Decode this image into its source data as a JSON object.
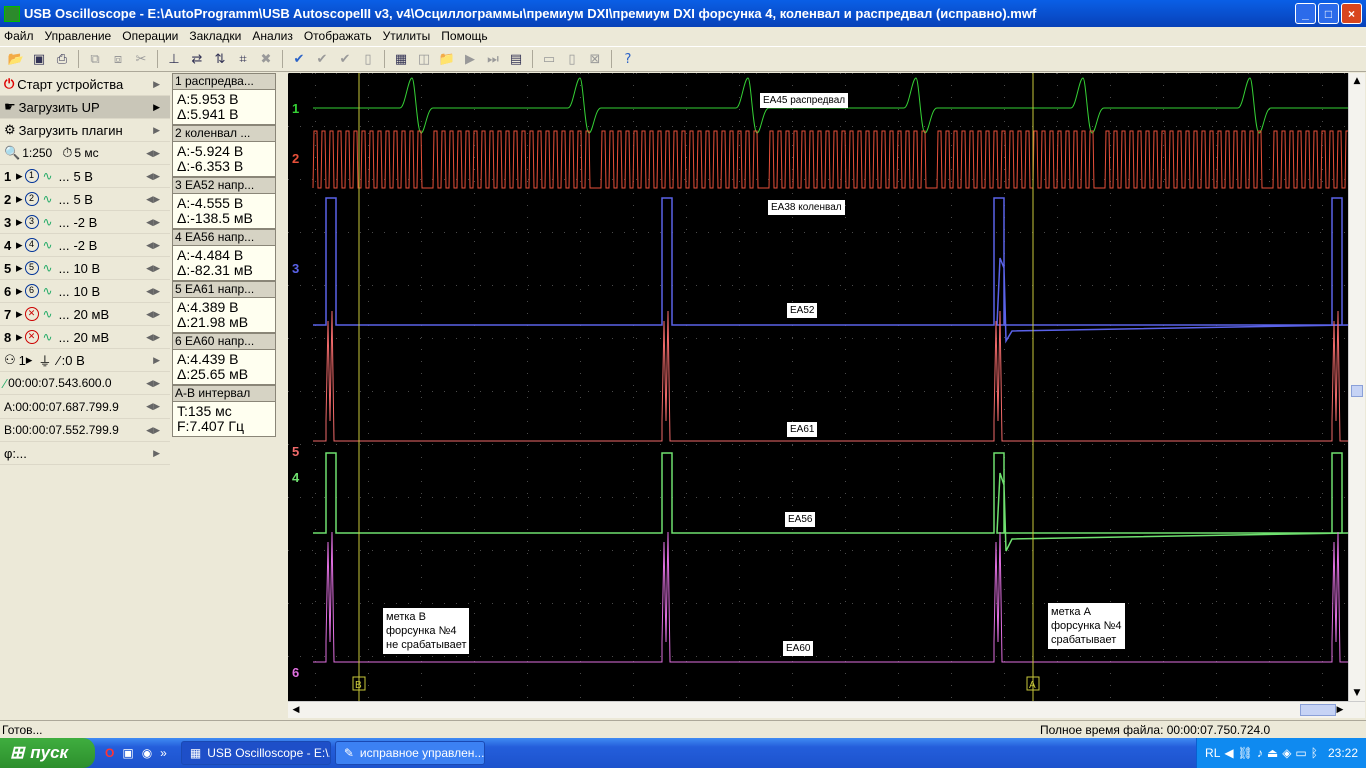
{
  "window": {
    "title": "USB Oscilloscope - E:\\AutoProgramm\\USB AutoscopeIII v3, v4\\Осциллограммы\\премиум DXI\\премиум DXI форсунка 4, коленвал и распредвал (исправно).mwf",
    "min": "_",
    "max": "□",
    "close": "×"
  },
  "menu": [
    "Файл",
    "Управление",
    "Операции",
    "Закладки",
    "Анализ",
    "Отображать",
    "Утилиты",
    "Помощь"
  ],
  "left": {
    "start": "Старт устройства",
    "load_up": "Загрузить UP",
    "load_plugin": "Загрузить плагин",
    "scale": "1:250",
    "timebase": "5 мс",
    "channels": [
      {
        "n": "1",
        "v": "5 В"
      },
      {
        "n": "2",
        "v": "5 В"
      },
      {
        "n": "3",
        "v": "-2 В"
      },
      {
        "n": "4",
        "v": "-2 В"
      },
      {
        "n": "5",
        "v": "10 В"
      },
      {
        "n": "6",
        "v": "10 В"
      },
      {
        "n": "7",
        "v": "20 мВ"
      },
      {
        "n": "8",
        "v": "20 мВ"
      }
    ],
    "trigger": "1",
    "trigger_level": "0 В",
    "trig_time": "00:00:07.543.600.0",
    "a_time": "A:00:00:07.687.799.9",
    "b_time": "B:00:00:07.552.799.9",
    "phi": "φ:..."
  },
  "meas": [
    {
      "h": "1 распредва...",
      "a": "A:5.953 В",
      "d": "Δ:5.941 В"
    },
    {
      "h": "2 коленвал ...",
      "a": "A:-5.924 В",
      "d": "Δ:-6.353 В"
    },
    {
      "h": "3 EA52 напр...",
      "a": "A:-4.555 В",
      "d": "Δ:-138.5 мВ"
    },
    {
      "h": "4 EA56 напр...",
      "a": "A:-4.484 В",
      "d": "Δ:-82.31 мВ"
    },
    {
      "h": "5 EA61 напр...",
      "a": "A:4.389 В",
      "d": "Δ:21.98 мВ"
    },
    {
      "h": "6 EA60 напр...",
      "a": "A:4.439 В",
      "d": "Δ:25.65 мВ"
    },
    {
      "h": "A-B интервал",
      "a": "T:135 мс",
      "d": "F:7.407 Гц"
    }
  ],
  "scope": {
    "labels": [
      "EA45 распредвал",
      "EA38 коленвал",
      "EA52",
      "EA61",
      "EA56",
      "EA60"
    ],
    "note_b": [
      "метка В",
      "форсунка №4",
      "не срабатывает"
    ],
    "note_a": [
      "метка А",
      "форсунка №4",
      "срабатывает"
    ],
    "marker_a": "A",
    "marker_b": "B",
    "channel_nums": [
      "1",
      "2",
      "3",
      "4",
      "5",
      "6"
    ],
    "colors": {
      "ch1": "#35d035",
      "ch2": "#e8503a",
      "ch3": "#5a62e8",
      "ch4": "#6fe06f",
      "ch5": "#f06a6a",
      "ch6": "#e070e0",
      "grid": "#4a4a4a",
      "cursor": "#c8c83a"
    }
  },
  "status": {
    "left": "Готов...",
    "right": "Полное время файла: 00:00:07.750.724.0"
  },
  "taskbar": {
    "start": "пуск",
    "tasks": [
      "USB Oscilloscope - E:\\...",
      "исправное управлен..."
    ],
    "lang": "RL",
    "time": "23:22"
  }
}
